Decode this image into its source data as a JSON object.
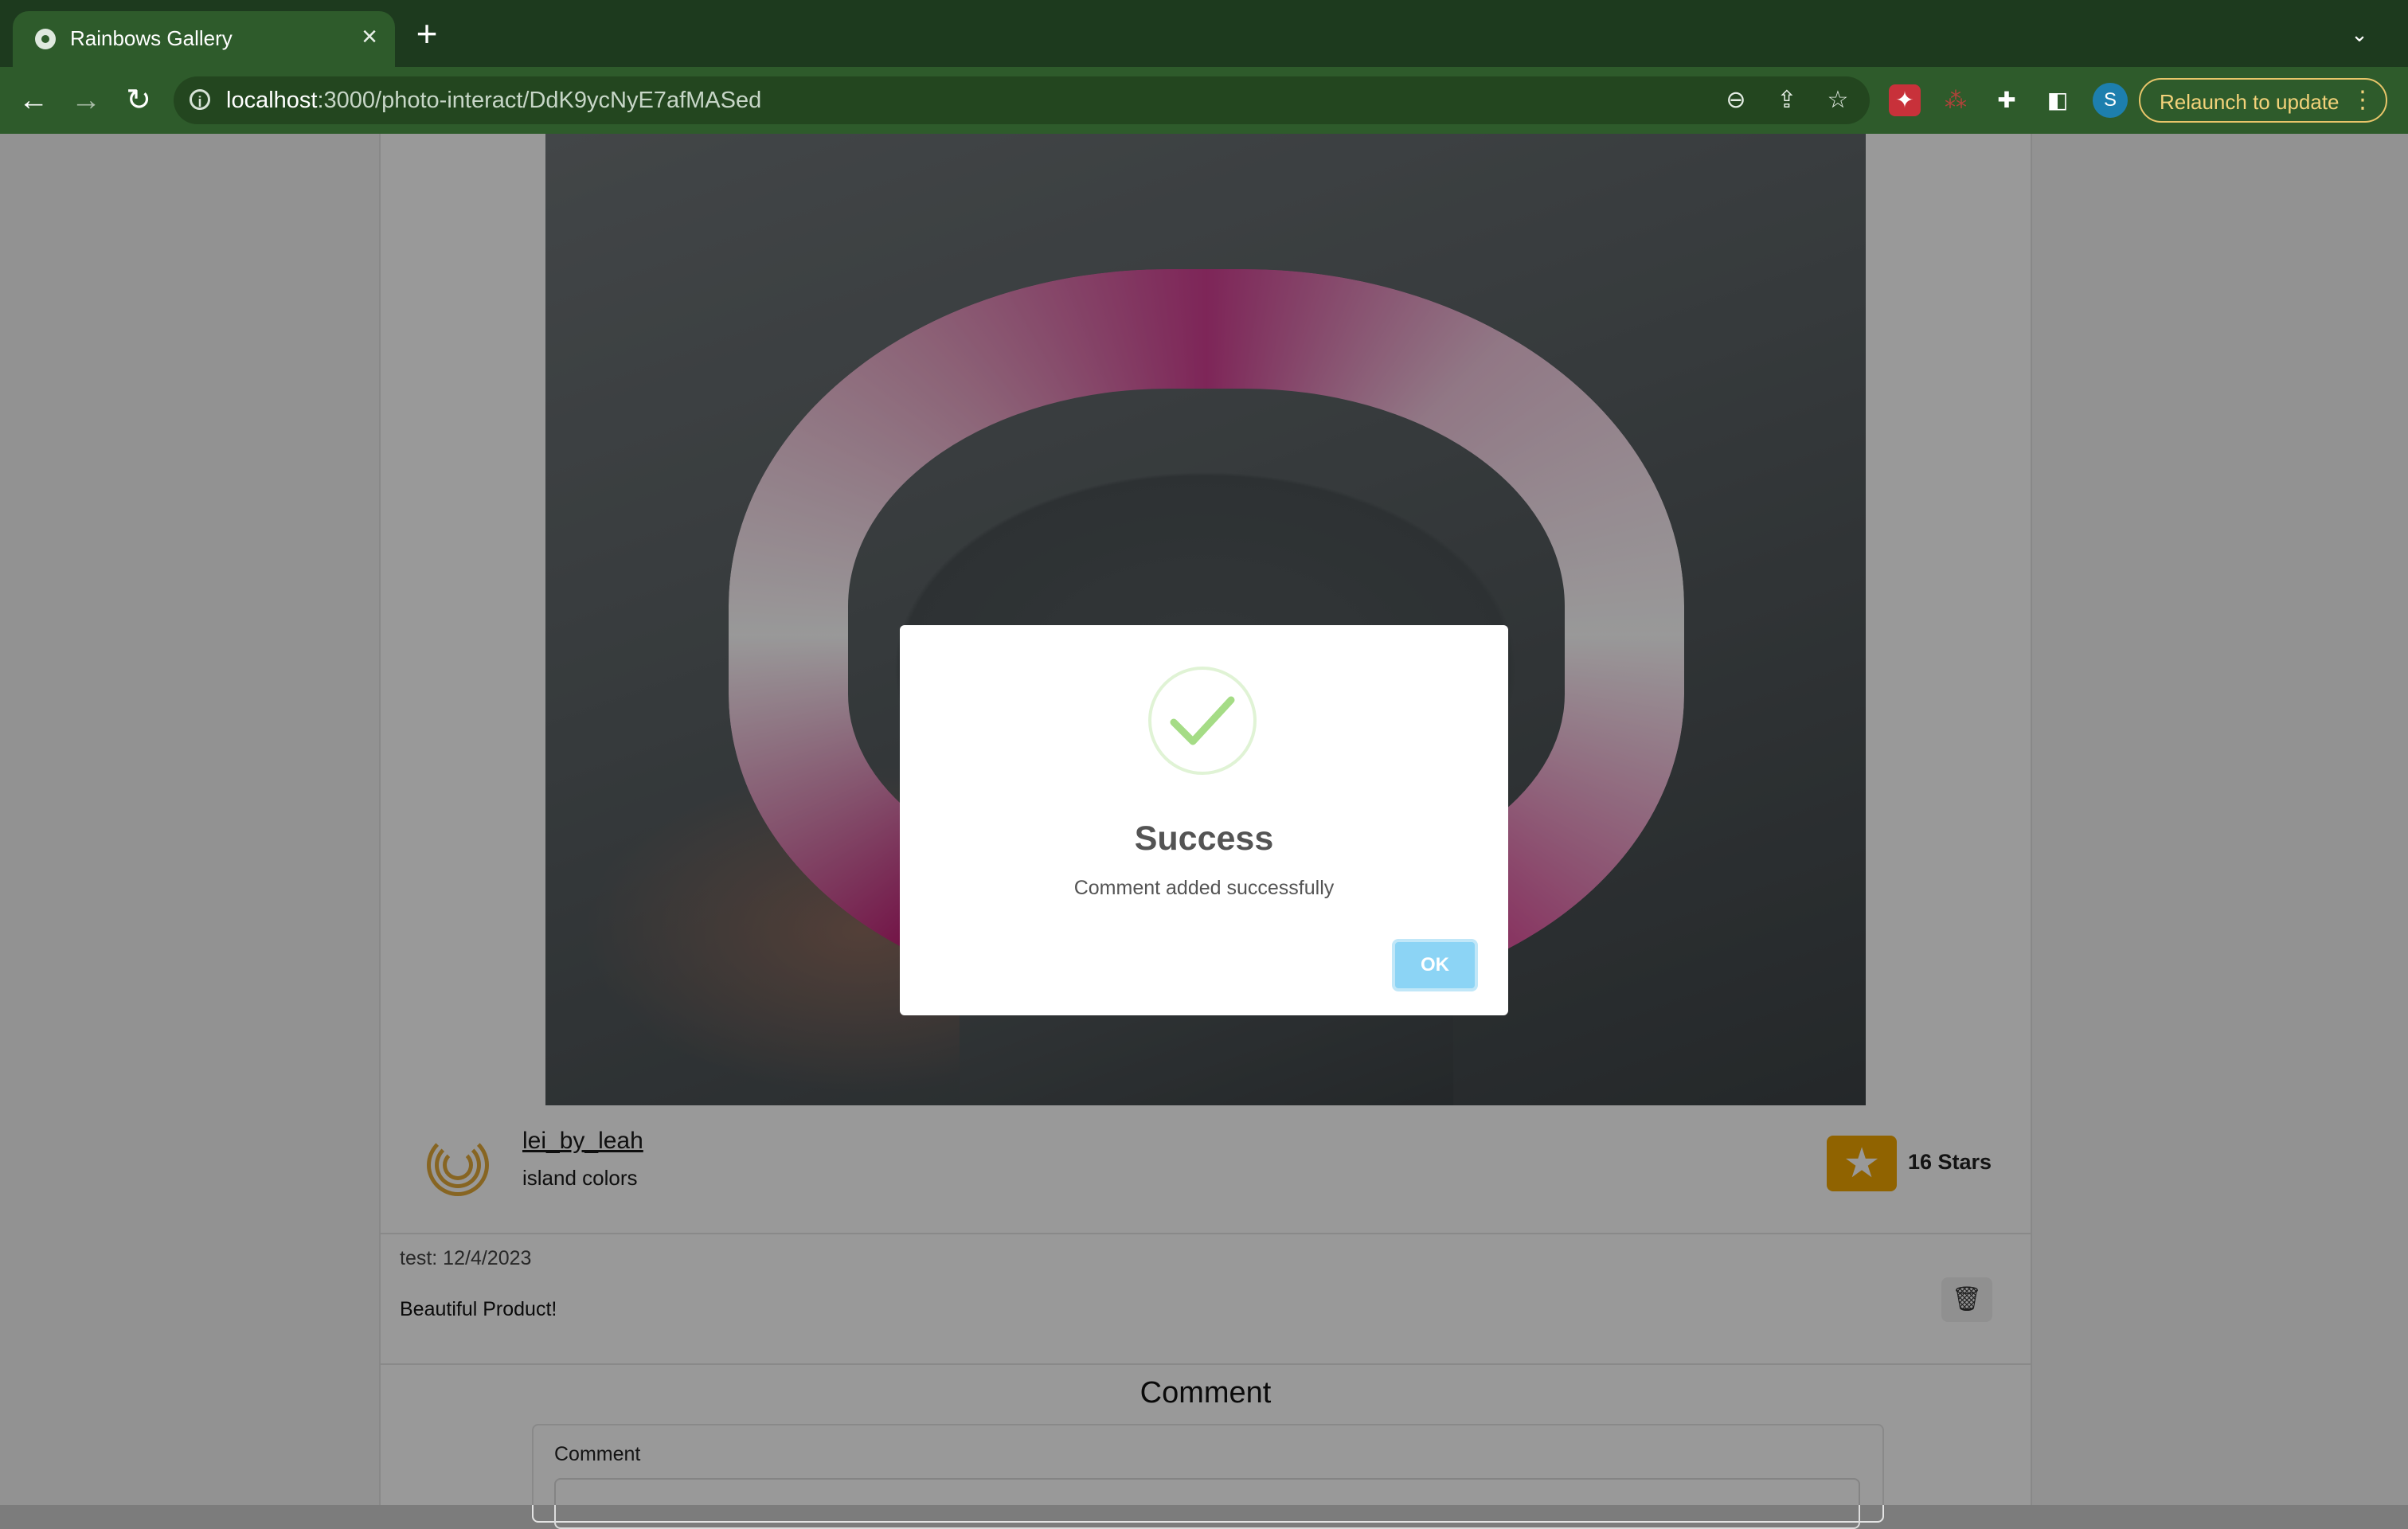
{
  "browser": {
    "tab_title": "Rainbows Gallery",
    "tab_close": "×",
    "new_tab": "+",
    "url_host": "localhost",
    "url_path": ":3000/photo-interact/DdK9ycNyE7afMASed",
    "profile_initial": "S",
    "relaunch_label": "Relaunch to update"
  },
  "post": {
    "username": "lei_by_leah",
    "caption": "island colors",
    "stars_label": "16 Stars"
  },
  "comments": [
    {
      "meta": "test: 12/4/2023",
      "text": "Beautiful Product!"
    }
  ],
  "comment_form": {
    "heading": "Comment",
    "label": "Comment"
  },
  "modal": {
    "title": "Success",
    "message": "Comment added successfully",
    "ok_label": "OK"
  },
  "colors": {
    "chrome_dark": "#1d3a1e",
    "chrome": "#2e5b2b",
    "relaunch_accent": "#f3d27a",
    "star_button": "#f0a500",
    "success_check": "#a5dc86",
    "ok_button": "#8cd4f5"
  },
  "icons": [
    "chrome-favicon",
    "close-icon",
    "plus-icon",
    "chevron-down-icon",
    "back-arrow-icon",
    "forward-arrow-icon",
    "reload-icon",
    "info-icon",
    "zoom-out-icon",
    "share-icon",
    "bookmark-star-icon",
    "extension-icon",
    "puzzle-icon",
    "side-panel-icon",
    "kebab-menu-icon",
    "star-icon",
    "trash-icon",
    "checkmark-icon"
  ]
}
